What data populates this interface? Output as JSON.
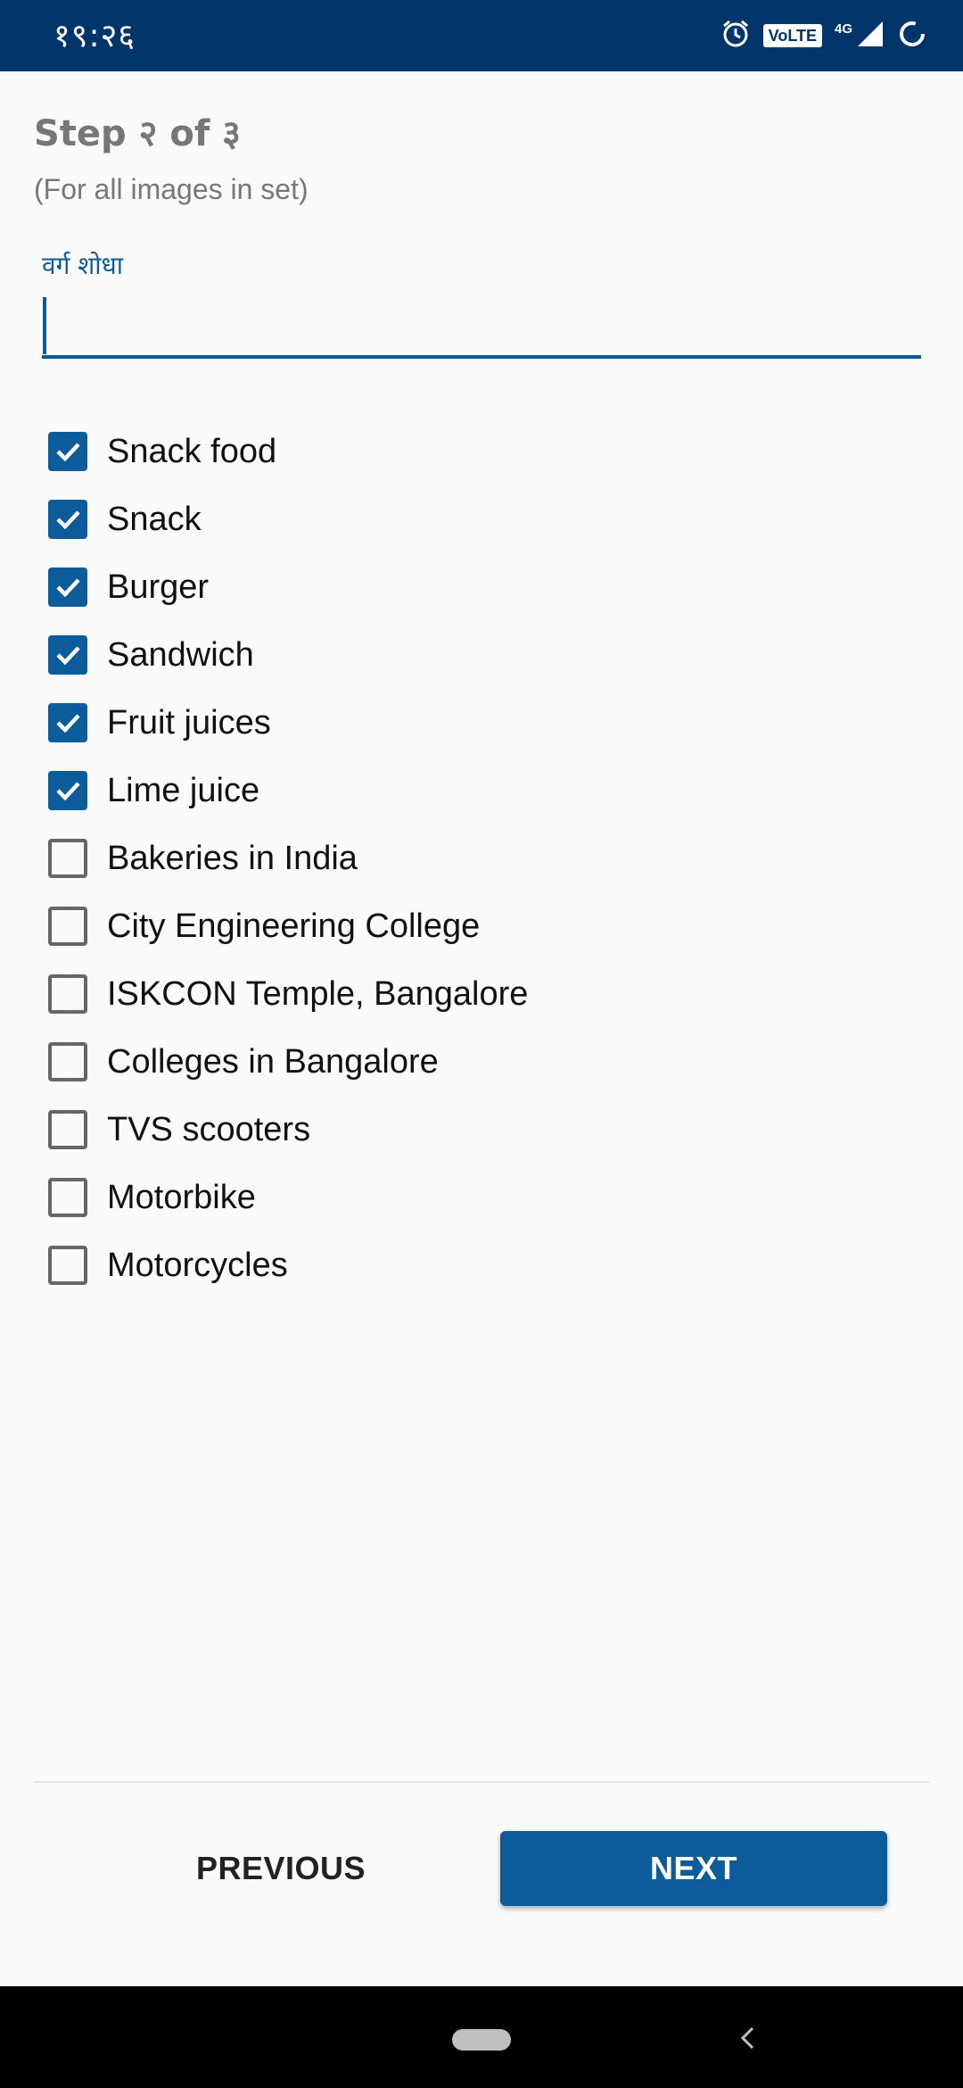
{
  "status_bar": {
    "time": "१९:२६",
    "volte_label": "VoLTE",
    "network_label": "4G",
    "icons": [
      "alarm-icon",
      "volte-icon",
      "signal-icon",
      "loading-icon"
    ]
  },
  "header": {
    "title": "Step २ of ३",
    "subtitle": "(For all images in set)"
  },
  "search": {
    "label": "वर्ग शोधा",
    "value": ""
  },
  "categories": [
    {
      "label": "Snack food",
      "checked": true
    },
    {
      "label": "Snack",
      "checked": true
    },
    {
      "label": "Burger",
      "checked": true
    },
    {
      "label": "Sandwich",
      "checked": true
    },
    {
      "label": "Fruit juices",
      "checked": true
    },
    {
      "label": "Lime juice",
      "checked": true
    },
    {
      "label": "Bakeries in India",
      "checked": false
    },
    {
      "label": "City Engineering College",
      "checked": false
    },
    {
      "label": "ISKCON Temple, Bangalore",
      "checked": false
    },
    {
      "label": "Colleges in Bangalore",
      "checked": false
    },
    {
      "label": "TVS scooters",
      "checked": false
    },
    {
      "label": "Motorbike",
      "checked": false
    },
    {
      "label": "Motorcycles",
      "checked": false
    }
  ],
  "footer": {
    "previous_label": "PREVIOUS",
    "next_label": "NEXT"
  },
  "colors": {
    "status_bar": "#00356b",
    "accent": "#0c5c9c"
  }
}
